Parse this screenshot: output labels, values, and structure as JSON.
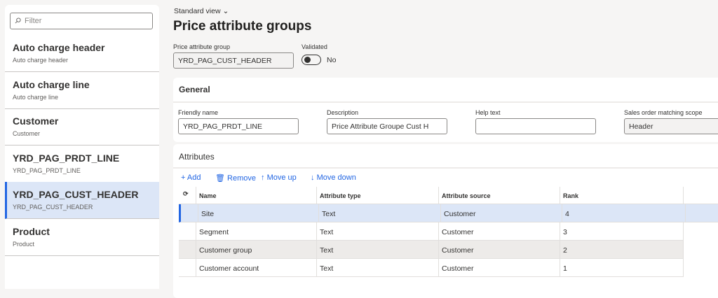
{
  "sidebar": {
    "filter_placeholder": "Filter",
    "items": [
      {
        "title": "Auto charge header",
        "subtitle": "Auto charge header"
      },
      {
        "title": "Auto charge line",
        "subtitle": "Auto charge line"
      },
      {
        "title": "Customer",
        "subtitle": "Customer"
      },
      {
        "title": "YRD_PAG_PRDT_LINE",
        "subtitle": "YRD_PAG_PRDT_LINE"
      },
      {
        "title": "YRD_PAG_CUST_HEADER",
        "subtitle": "YRD_PAG_CUST_HEADER",
        "selected": true
      },
      {
        "title": "Product",
        "subtitle": "Product"
      }
    ]
  },
  "header": {
    "view": "Standard view",
    "title": "Price attribute groups",
    "group_label": "Price attribute group",
    "group_value": "YRD_PAG_CUST_HEADER",
    "validated_label": "Validated",
    "validated_value": "No",
    "validated": false
  },
  "general": {
    "title": "General",
    "fields": [
      {
        "label": "Friendly name",
        "value": "YRD_PAG_PRDT_LINE"
      },
      {
        "label": "Description",
        "value": "Price Attribute Groupe Cust H"
      },
      {
        "label": "Help text",
        "value": ""
      },
      {
        "label": "Sales order matching scope",
        "value": "Header"
      }
    ]
  },
  "attributes": {
    "title": "Attributes",
    "toolbar": {
      "add": "Add",
      "remove": "Remove",
      "move_up": "Move up",
      "move_down": "Move down"
    },
    "columns": [
      "Name",
      "Attribute type",
      "Attribute source",
      "Rank"
    ],
    "rows": [
      [
        "Site",
        "Text",
        "Customer",
        "4"
      ],
      [
        "Segment",
        "Text",
        "Customer",
        "3"
      ],
      [
        "Customer group",
        "Text",
        "Customer",
        "2"
      ],
      [
        "Customer account",
        "Text",
        "Customer",
        "1"
      ]
    ]
  },
  "colors": {
    "accent": "#2266e3",
    "selected_bg": "#dce6f7"
  }
}
